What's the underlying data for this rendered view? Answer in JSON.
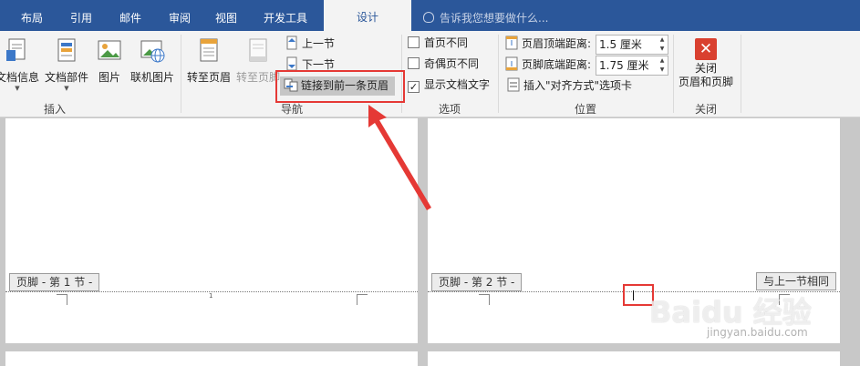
{
  "tabs": [
    {
      "label": "布局",
      "active": false
    },
    {
      "label": "引用",
      "active": false
    },
    {
      "label": "邮件",
      "active": false
    },
    {
      "label": "审阅",
      "active": false
    },
    {
      "label": "视图",
      "active": false
    },
    {
      "label": "开发工具",
      "active": false
    },
    {
      "label": "设计",
      "active": true
    }
  ],
  "tell_me": "告诉我您想要做什么...",
  "insert_group": {
    "label": "插入",
    "buttons": [
      {
        "label": "文档信息",
        "icon": "doc-info-icon"
      },
      {
        "label": "文档部件",
        "icon": "doc-parts-icon"
      },
      {
        "label": "图片",
        "icon": "picture-icon"
      },
      {
        "label": "联机图片",
        "icon": "online-picture-icon"
      }
    ]
  },
  "nav_group": {
    "label": "导航",
    "goto_header": "转至页眉",
    "goto_footer": "转至页脚",
    "prev_section": "上一节",
    "next_section": "下一节",
    "link_previous": "链接到前一条页眉"
  },
  "options_group": {
    "label": "选项",
    "first_page": {
      "label": "首页不同",
      "checked": false
    },
    "odd_even": {
      "label": "奇偶页不同",
      "checked": false
    },
    "show_text": {
      "label": "显示文档文字",
      "checked": true
    }
  },
  "position_group": {
    "label": "位置",
    "header_top_label": "页眉顶端距离:",
    "header_top_value": "1.5 厘米",
    "footer_bottom_label": "页脚底端距离:",
    "footer_bottom_value": "1.75 厘米",
    "insert_align_tab": "插入\"对齐方式\"选项卡"
  },
  "close_group": {
    "label": "关闭",
    "close_line1": "关闭",
    "close_line2": "页眉和页脚"
  },
  "document": {
    "footer_tag_1": "页脚 - 第 1 节 -",
    "footer_tag_2": "页脚 - 第 2 节 -",
    "same_as_previous": "与上一节相同",
    "page_number_1": "1"
  },
  "watermark": {
    "brand": "Baidu 经验",
    "url": "jingyan.baidu.com"
  },
  "colors": {
    "tab_bar": "#2b579a",
    "ribbon": "#f3f3f3",
    "highlight": "#e53935",
    "close_button": "#d9402f"
  }
}
